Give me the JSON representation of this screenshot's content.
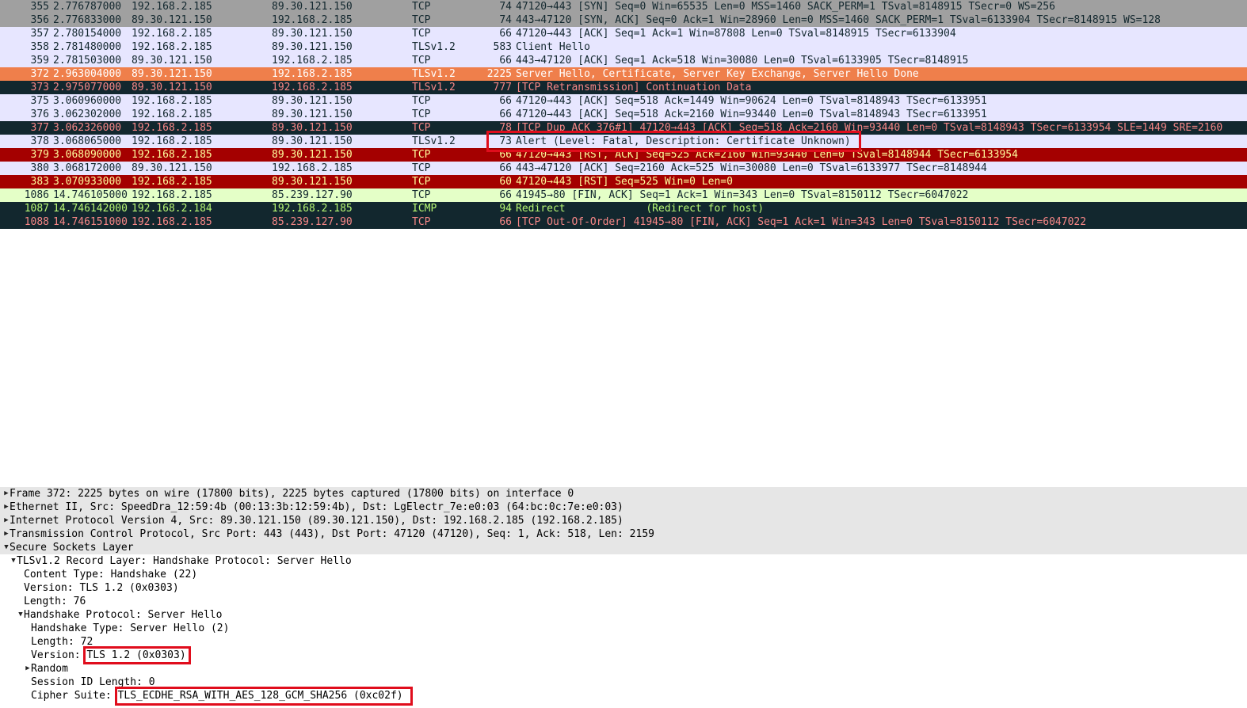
{
  "packet_list": {
    "rows": [
      {
        "no": "355",
        "time": "2.776787000",
        "src": "192.168.2.185",
        "dst": "89.30.121.150",
        "proto": "TCP",
        "len": "74",
        "info": "47120→443 [SYN] Seq=0 Win=65535 Len=0 MSS=1460 SACK_PERM=1 TSval=8148915 TSecr=0 WS=256",
        "bg": "#a0a0a0",
        "fg": "#12272e"
      },
      {
        "no": "356",
        "time": "2.776833000",
        "src": "89.30.121.150",
        "dst": "192.168.2.185",
        "proto": "TCP",
        "len": "74",
        "info": "443→47120 [SYN, ACK] Seq=0 Ack=1 Win=28960 Len=0 MSS=1460 SACK_PERM=1 TSval=6133904 TSecr=8148915 WS=128",
        "bg": "#a0a0a0",
        "fg": "#12272e"
      },
      {
        "no": "357",
        "time": "2.780154000",
        "src": "192.168.2.185",
        "dst": "89.30.121.150",
        "proto": "TCP",
        "len": "66",
        "info": "47120→443 [ACK] Seq=1 Ack=1 Win=87808 Len=0 TSval=8148915 TSecr=6133904",
        "bg": "#e7e6ff",
        "fg": "#12272e"
      },
      {
        "no": "358",
        "time": "2.781480000",
        "src": "192.168.2.185",
        "dst": "89.30.121.150",
        "proto": "TLSv1.2",
        "len": "583",
        "info": "Client Hello",
        "bg": "#e7e6ff",
        "fg": "#12272e"
      },
      {
        "no": "359",
        "time": "2.781503000",
        "src": "89.30.121.150",
        "dst": "192.168.2.185",
        "proto": "TCP",
        "len": "66",
        "info": "443→47120 [ACK] Seq=1 Ack=518 Win=30080 Len=0 TSval=6133905 TSecr=8148915",
        "bg": "#e7e6ff",
        "fg": "#12272e"
      },
      {
        "no": "372",
        "time": "2.963004000",
        "src": "89.30.121.150",
        "dst": "192.168.2.185",
        "proto": "TLSv1.2",
        "len": "2225",
        "info": "Server Hello, Certificate, Server Key Exchange, Server Hello Done",
        "bg": "#ef7f4b",
        "fg": "#ffffff"
      },
      {
        "no": "373",
        "time": "2.975077000",
        "src": "89.30.121.150",
        "dst": "192.168.2.185",
        "proto": "TLSv1.2",
        "len": "777",
        "info": "[TCP Retransmission] Continuation Data",
        "bg": "#12272e",
        "fg": "#f78787"
      },
      {
        "no": "375",
        "time": "3.060960000",
        "src": "192.168.2.185",
        "dst": "89.30.121.150",
        "proto": "TCP",
        "len": "66",
        "info": "47120→443 [ACK] Seq=518 Ack=1449 Win=90624 Len=0 TSval=8148943 TSecr=6133951",
        "bg": "#e7e6ff",
        "fg": "#12272e"
      },
      {
        "no": "376",
        "time": "3.062302000",
        "src": "192.168.2.185",
        "dst": "89.30.121.150",
        "proto": "TCP",
        "len": "66",
        "info": "47120→443 [ACK] Seq=518 Ack=2160 Win=93440 Len=0 TSval=8148943 TSecr=6133951",
        "bg": "#e7e6ff",
        "fg": "#12272e"
      },
      {
        "no": "377",
        "time": "3.062326000",
        "src": "192.168.2.185",
        "dst": "89.30.121.150",
        "proto": "TCP",
        "len": "78",
        "info": "[TCP Dup ACK 376#1] 47120→443 [ACK] Seq=518 Ack=2160 Win=93440 Len=0 TSval=8148943 TSecr=6133954 SLE=1449 SRE=2160",
        "bg": "#12272e",
        "fg": "#f78787"
      },
      {
        "no": "378",
        "time": "3.068065000",
        "src": "192.168.2.185",
        "dst": "89.30.121.150",
        "proto": "TLSv1.2",
        "len": "73",
        "info": "Alert (Level: Fatal, Description: Certificate Unknown)",
        "bg": "#e7e6ff",
        "fg": "#12272e"
      },
      {
        "no": "379",
        "time": "3.068090000",
        "src": "192.168.2.185",
        "dst": "89.30.121.150",
        "proto": "TCP",
        "len": "66",
        "info": "47120→443 [RST, ACK] Seq=525 Ack=2160 Win=93440 Len=0 TSval=8148944 TSecr=6133954",
        "bg": "#a40000",
        "fg": "#fffc9c"
      },
      {
        "no": "380",
        "time": "3.068172000",
        "src": "89.30.121.150",
        "dst": "192.168.2.185",
        "proto": "TCP",
        "len": "66",
        "info": "443→47120 [ACK] Seq=2160 Ack=525 Win=30080 Len=0 TSval=6133977 TSecr=8148944",
        "bg": "#e7e6ff",
        "fg": "#12272e"
      },
      {
        "no": "383",
        "time": "3.070933000",
        "src": "192.168.2.185",
        "dst": "89.30.121.150",
        "proto": "TCP",
        "len": "60",
        "info": "47120→443 [RST] Seq=525 Win=0 Len=0",
        "bg": "#a40000",
        "fg": "#fffc9c"
      },
      {
        "no": "1086",
        "time": "14.746105000",
        "src": "192.168.2.185",
        "dst": "85.239.127.90",
        "proto": "TCP",
        "len": "66",
        "info": "41945→80 [FIN, ACK] Seq=1 Ack=1 Win=343 Len=0 TSval=8150112 TSecr=6047022",
        "bg": "#e4ffc7",
        "fg": "#12272e"
      },
      {
        "no": "1087",
        "time": "14.746142000",
        "src": "192.168.2.184",
        "dst": "192.168.2.185",
        "proto": "ICMP",
        "len": "94",
        "info": "Redirect             (Redirect for host)",
        "bg": "#12272e",
        "fg": "#b7f774"
      },
      {
        "no": "1088",
        "time": "14.746151000",
        "src": "192.168.2.185",
        "dst": "85.239.127.90",
        "proto": "TCP",
        "len": "66",
        "info": "[TCP Out-Of-Order] 41945→80 [FIN, ACK] Seq=1 Ack=1 Win=343 Len=0 TSval=8150112 TSecr=6047022",
        "bg": "#12272e",
        "fg": "#f78787"
      }
    ]
  },
  "detail_tree": {
    "nodes": [
      {
        "text": "Frame 372: 2225 bytes on wire (17800 bits), 2225 bytes captured (17800 bits) on interface 0",
        "level": 0,
        "arrow": "collapsed",
        "top": true
      },
      {
        "text": "Ethernet II, Src: SpeedDra_12:59:4b (00:13:3b:12:59:4b), Dst: LgElectr_7e:e0:03 (64:bc:0c:7e:e0:03)",
        "level": 0,
        "arrow": "collapsed",
        "top": true
      },
      {
        "text": "Internet Protocol Version 4, Src: 89.30.121.150 (89.30.121.150), Dst: 192.168.2.185 (192.168.2.185)",
        "level": 0,
        "arrow": "collapsed",
        "top": true
      },
      {
        "text": "Transmission Control Protocol, Src Port: 443 (443), Dst Port: 47120 (47120), Seq: 1, Ack: 518, Len: 2159",
        "level": 0,
        "arrow": "collapsed",
        "top": true
      },
      {
        "text": "Secure Sockets Layer",
        "level": 0,
        "arrow": "expanded",
        "top": true
      },
      {
        "text": "TLSv1.2 Record Layer: Handshake Protocol: Server Hello",
        "level": 1,
        "arrow": "expanded",
        "top": false
      },
      {
        "text": "Content Type: Handshake (22)",
        "level": 2,
        "arrow": "none",
        "top": false
      },
      {
        "text": "Version: TLS 1.2 (0x0303)",
        "level": 2,
        "arrow": "none",
        "top": false
      },
      {
        "text": "Length: 76",
        "level": 2,
        "arrow": "none",
        "top": false
      },
      {
        "text": "Handshake Protocol: Server Hello",
        "level": 2,
        "arrow": "expanded",
        "top": false
      },
      {
        "text": "Handshake Type: Server Hello (2)",
        "level": 3,
        "arrow": "none",
        "top": false
      },
      {
        "text": "Length: 72",
        "level": 3,
        "arrow": "none",
        "top": false
      },
      {
        "text": "Version: TLS 1.2 (0x0303)",
        "level": 3,
        "arrow": "none",
        "top": false
      },
      {
        "text": "Random",
        "level": 3,
        "arrow": "collapsed",
        "top": false
      },
      {
        "text": "Session ID Length: 0",
        "level": 3,
        "arrow": "none",
        "top": false
      },
      {
        "text": "Cipher Suite: TLS_ECDHE_RSA_WITH_AES_128_GCM_SHA256 (0xc02f)",
        "level": 3,
        "arrow": "none",
        "top": false
      }
    ]
  },
  "highlight_color": "#e00d1c"
}
